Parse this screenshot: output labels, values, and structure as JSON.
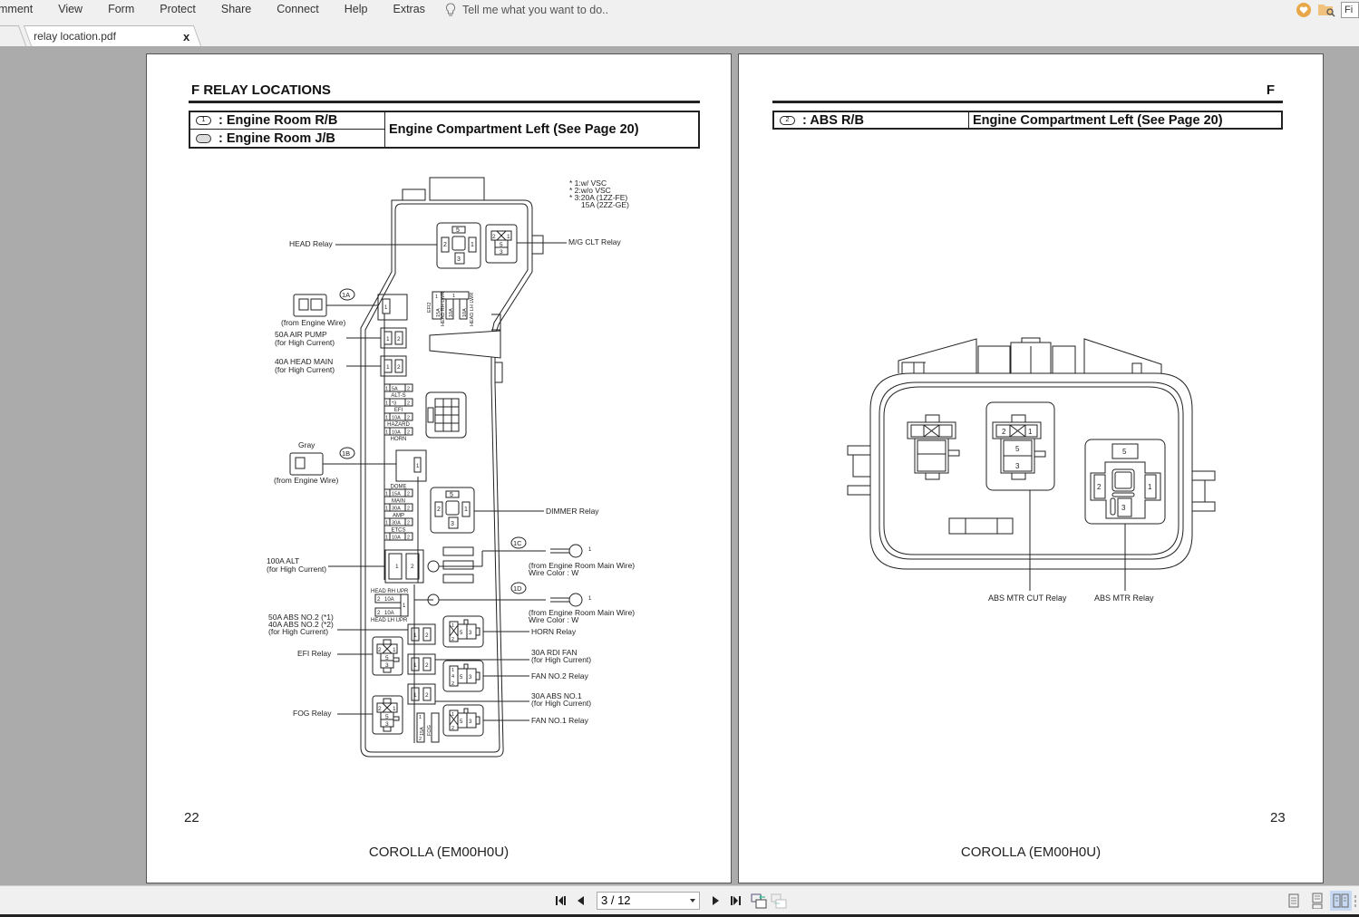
{
  "menu": [
    "mment",
    "View",
    "Form",
    "Protect",
    "Share",
    "Connect",
    "Help",
    "Extras"
  ],
  "tell_me_placeholder": "Tell me what you want to do..",
  "find_box_text": "Fi",
  "tabs": {
    "active": "relay location.pdf",
    "close_glyph": "x"
  },
  "left_page": {
    "section_title": "F  RELAY LOCATIONS",
    "location_rows": [
      {
        "badge": "1",
        "label": ": Engine Room R/B"
      },
      {
        "badge": "",
        "label": ": Engine Room J/B"
      }
    ],
    "location": "Engine Compartment Left (See Page 20)",
    "notes": [
      "* 1:w/ VSC",
      "* 2:w/o VSC",
      "* 3:20A (1ZZ-FE)",
      "15A (2ZZ-GE)"
    ],
    "callouts": {
      "head_relay": "HEAD Relay",
      "mg_clt_relay": "M/G CLT Relay",
      "c1a": "1A",
      "from_engine_wire_a": "(from Engine Wire)",
      "air_pump": "50A AIR PUMP",
      "air_pump_sub": "(for High Current)",
      "head_main": "40A HEAD MAIN",
      "head_main_sub": "(for High Current)",
      "gray": "Gray",
      "c1b": "1B",
      "from_engine_wire_b": "(from Engine Wire)",
      "dimmer_relay": "DIMMER Relay",
      "alt": "100A ALT",
      "alt_sub": "(for High Current)",
      "c1c": "1C",
      "c1d": "1D",
      "main_wire_c": "(from Engine Room Main Wire)",
      "wire_color_c": "Wire Color : W",
      "main_wire_d": "(from Engine Room Main Wire)",
      "wire_color_d": "Wire Color : W",
      "abs2_a": "50A ABS NO.2 (*1)",
      "abs2_b": "40A ABS NO.2 (*2)",
      "abs2_sub": "(for High Current)",
      "horn_relay": "HORN Relay",
      "efi_relay": "EFI Relay",
      "rdi_fan": "30A RDI FAN",
      "rdi_fan_sub": "(for High Current)",
      "fan2_relay": "FAN NO.2 Relay",
      "abs1": "30A ABS NO.1",
      "abs1_sub": "(for High Current)",
      "fog_relay": "FOG Relay",
      "fan1_relay": "FAN NO.1 Relay"
    },
    "fuses": [
      {
        "amp": "5A",
        "name": "ALT-S"
      },
      {
        "amp": "*3",
        "name": "EFI"
      },
      {
        "amp": "10A",
        "name": "HAZARD"
      },
      {
        "amp": "10A",
        "name": "HORN"
      },
      {
        "amp": "15A",
        "name": "DOME",
        "above": true
      },
      {
        "amp": "30A",
        "name": "MAIN",
        "above": true
      },
      {
        "amp": "30A",
        "name": "AMP",
        "above": true
      },
      {
        "amp": "10A",
        "name": "ETCS",
        "above": true
      }
    ],
    "head_fuses": {
      "upper": "HEAD RH UPR",
      "lower": "HEAD LH UPR",
      "amp": "10A"
    },
    "top_fuses": {
      "efi2": "EFI2",
      "efi2_amp": "15A",
      "rh": "HEAD RH LWR",
      "lh": "HEAD LH LWR",
      "amp": "10A"
    },
    "fog_fuse": {
      "amp": "15A",
      "name": "FOG"
    },
    "page_number": "22",
    "footer": "COROLLA (EM00H0U)"
  },
  "right_page": {
    "section_letter": "F",
    "location_rows": [
      {
        "badge": "2",
        "label": ": ABS R/B"
      }
    ],
    "location": "Engine Compartment Left (See Page 20)",
    "callouts": {
      "abs_mtr_cut": "ABS MTR CUT Relay",
      "abs_mtr": "ABS MTR Relay"
    },
    "page_number": "23",
    "footer": "COROLLA (EM00H0U)"
  },
  "navigation": {
    "page_display": "3 / 12",
    "current_page": 3,
    "total_pages": 12
  },
  "colors": {
    "accent_orange": "#e8a84a",
    "active_view": "#c6d8f2",
    "viewer_bg": "#ababab"
  }
}
